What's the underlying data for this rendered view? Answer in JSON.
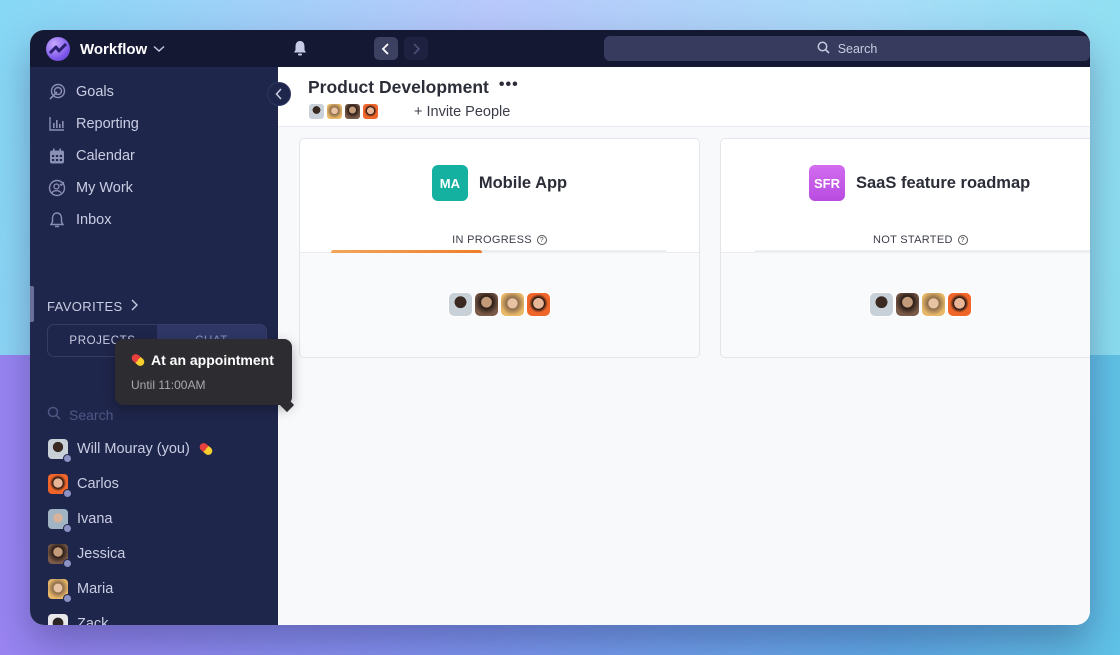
{
  "app": {
    "name": "Workflow"
  },
  "topbar": {
    "search_label": "Search"
  },
  "sidebar": {
    "nav": [
      {
        "label": "Goals",
        "icon": "goals-icon"
      },
      {
        "label": "Reporting",
        "icon": "reporting-icon"
      },
      {
        "label": "Calendar",
        "icon": "calendar-icon"
      },
      {
        "label": "My Work",
        "icon": "my-work-icon"
      },
      {
        "label": "Inbox",
        "icon": "inbox-icon"
      }
    ],
    "favorites_label": "FAVORITES",
    "segments": {
      "projects": "PROJECTS",
      "chat": "CHAT",
      "active": "CHAT"
    },
    "search_placeholder": "Search",
    "users": [
      {
        "name": "Will Mouray (you)",
        "status_emoji": "pill"
      },
      {
        "name": "Carlos"
      },
      {
        "name": "Ivana"
      },
      {
        "name": "Jessica"
      },
      {
        "name": "Maria"
      },
      {
        "name": "Zack"
      }
    ]
  },
  "tooltip": {
    "title": "At an appointment",
    "subtitle": "Until 11:00AM"
  },
  "header": {
    "title": "Product Development",
    "more": "•••",
    "invite": "+ Invite People"
  },
  "projects": [
    {
      "initials": "MA",
      "name": "Mobile App",
      "status": "IN PROGRESS",
      "progress": 0.45,
      "color": "#14b1a0"
    },
    {
      "initials": "SFR",
      "name": "SaaS feature roadmap",
      "status": "NOT STARTED",
      "progress": 0,
      "color": "#c757e8"
    }
  ]
}
